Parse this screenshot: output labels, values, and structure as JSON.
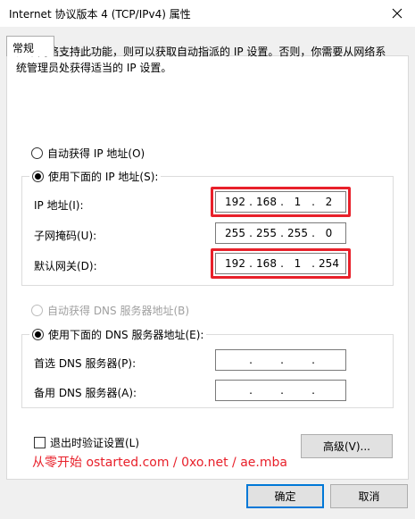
{
  "window": {
    "title": "Internet 协议版本 4 (TCP/IPv4) 属性"
  },
  "tab": {
    "label": "常规"
  },
  "description": "如果网络支持此功能，则可以获取自动指派的 IP 设置。否则，你需要从网络系统管理员处获得适当的 IP 设置。",
  "ip_mode": {
    "auto_label": "自动获得 IP 地址(O)",
    "manual_label": "使用下面的 IP 地址(S):",
    "selected": "manual"
  },
  "ip_fields": {
    "ip_label": "IP 地址(I):",
    "ip_value": [
      "192",
      "168",
      "1",
      "2"
    ],
    "mask_label": "子网掩码(U):",
    "mask_value": [
      "255",
      "255",
      "255",
      "0"
    ],
    "gateway_label": "默认网关(D):",
    "gateway_value": [
      "192",
      "168",
      "1",
      "254"
    ]
  },
  "dns_mode": {
    "auto_label": "自动获得 DNS 服务器地址(B)",
    "manual_label": "使用下面的 DNS 服务器地址(E):",
    "selected": "manual"
  },
  "dns_fields": {
    "preferred_label": "首选 DNS 服务器(P):",
    "preferred_value": [
      "",
      "",
      "",
      ""
    ],
    "alternate_label": "备用 DNS 服务器(A):",
    "alternate_value": [
      "",
      "",
      "",
      ""
    ]
  },
  "validate_checkbox": {
    "label": "退出时验证设置(L)",
    "checked": false
  },
  "advanced_button": "高级(V)...",
  "ok_button": "确定",
  "cancel_button": "取消",
  "watermark": "从零开始 ostarted.com / 0xo.net / ae.mba",
  "colors": {
    "highlight": "#e8202a",
    "accent": "#0078d7"
  }
}
